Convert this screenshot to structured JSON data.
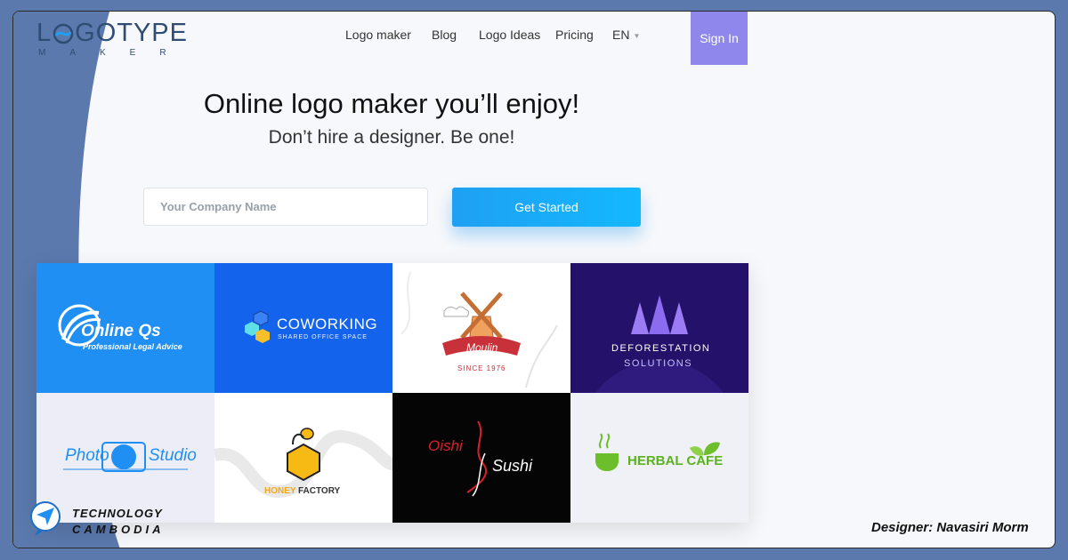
{
  "logo": {
    "word_left": "L",
    "word_right": "GOTYPE",
    "sub": "MAKER"
  },
  "nav": {
    "items": [
      {
        "label": "Logo maker"
      },
      {
        "label": "Blog"
      },
      {
        "label": "Logo Ideas"
      },
      {
        "label": "Pricing"
      }
    ],
    "language": "EN",
    "sign_in": "Sign In"
  },
  "hero": {
    "title": "Online logo maker you’ll enjoy!",
    "subtitle": "Don’t hire a designer. Be one!",
    "input_placeholder": "Your Company Name",
    "cta": "Get Started"
  },
  "logos": [
    {
      "name": "Online Qs",
      "tagline": "Professional Legal Advice"
    },
    {
      "name": "COWORKING",
      "tagline": "SHARED OFFICE SPACE"
    },
    {
      "name": "Moulin",
      "tagline": "SINCE 1976"
    },
    {
      "name": "DEFORESTATION",
      "tagline": "SOLUTIONS"
    },
    {
      "name": "Photo",
      "tagline": "Studio"
    },
    {
      "name": "HONEY",
      "tagline": "FACTORY"
    },
    {
      "name": "Oishi",
      "tagline": "Sushi"
    },
    {
      "name": "HERBAL CAFE",
      "tagline": ""
    }
  ],
  "footer": {
    "brand_line1": "TECHNOLOGY",
    "brand_line2": "CAMBODIA",
    "designer": "Designer: Navasiri Morm"
  },
  "colors": {
    "page_bg": "#5b79ad",
    "sign_in_bg": "#8f87ec",
    "cta_bg": "#1fa0f2",
    "text_dark": "#111111"
  }
}
